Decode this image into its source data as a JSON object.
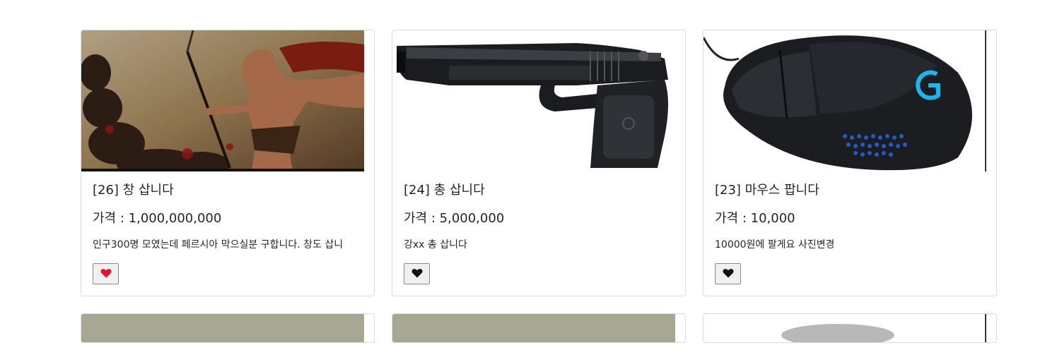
{
  "products": [
    {
      "title": "[26] 창 삽니다",
      "price_label": "가격 : ",
      "price": "1,000,000,000",
      "description": "인구300명 모였는데 페르시아 막으실분 구합니다. 창도 삽니",
      "image_icon": "spartan-warrior-image",
      "liked": true,
      "heart_color": "#e8102a"
    },
    {
      "title": "[24] 총 삽니다",
      "price_label": "가격 : ",
      "price": "5,000,000",
      "description": "강xx 총 삽니다",
      "image_icon": "pistol-image",
      "liked": false,
      "heart_color": "#111111"
    },
    {
      "title": "[23] 마우스 팝니다",
      "price_label": "가격 : ",
      "price": "10,000",
      "description": "10000원에 팔게요 사진변경",
      "image_icon": "gaming-mouse-image",
      "liked": false,
      "heart_color": "#111111"
    }
  ],
  "heart_icon": "heart-icon"
}
